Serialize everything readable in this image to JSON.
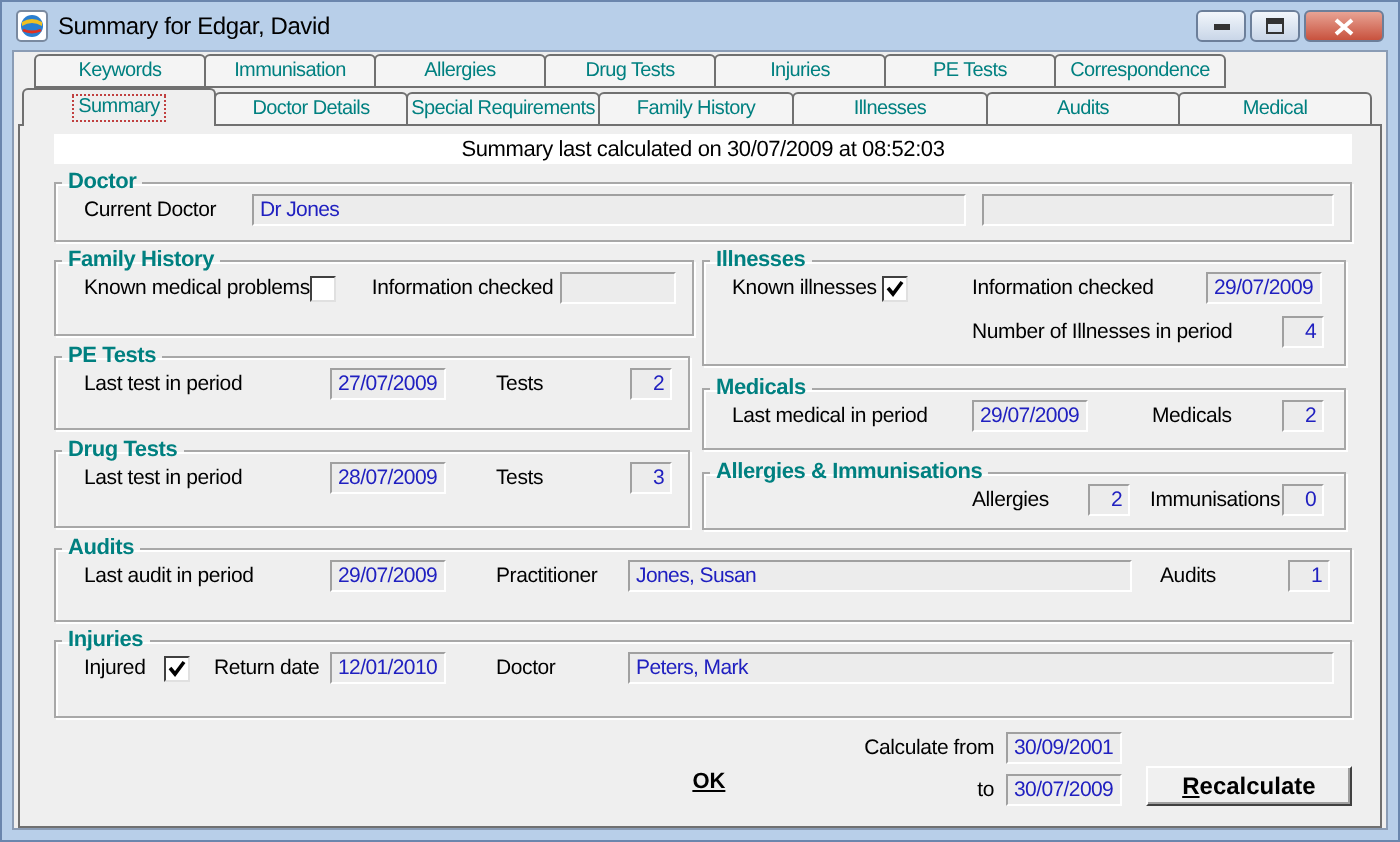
{
  "window": {
    "title": "Summary for Edgar, David"
  },
  "tab_rows": [
    {
      "tabs": [
        {
          "label": "Keywords",
          "selected": false
        },
        {
          "label": "Immunisation",
          "selected": false
        },
        {
          "label": "Allergies",
          "selected": false
        },
        {
          "label": "Drug Tests",
          "selected": false
        },
        {
          "label": "Injuries",
          "selected": false
        },
        {
          "label": "PE Tests",
          "selected": false
        },
        {
          "label": "Correspondence",
          "selected": false
        }
      ]
    },
    {
      "tabs": [
        {
          "label": "Summary",
          "selected": true
        },
        {
          "label": "Doctor Details",
          "selected": false
        },
        {
          "label": "Special Requirements",
          "selected": false
        },
        {
          "label": "Family History",
          "selected": false
        },
        {
          "label": "Illnesses",
          "selected": false
        },
        {
          "label": "Audits",
          "selected": false
        },
        {
          "label": "Medical",
          "selected": false
        }
      ]
    }
  ],
  "summary_line": "Summary last calculated on 30/07/2009 at 08:52:03",
  "doctor": {
    "title": "Doctor",
    "label": "Current Doctor",
    "value": "Dr Jones"
  },
  "family_history": {
    "title": "Family History",
    "known_label": "Known medical problems",
    "known_checked": false,
    "checked_label": "Information checked"
  },
  "illnesses": {
    "title": "Illnesses",
    "known_label": "Known illnesses",
    "known_checked": true,
    "checked_label": "Information checked",
    "checked_value": "29/07/2009",
    "count_label": "Number of Illnesses in period",
    "count": "4"
  },
  "pe_tests": {
    "title": "PE Tests",
    "last_label": "Last test in period",
    "last_value": "27/07/2009",
    "count_label": "Tests",
    "count": "2"
  },
  "medicals": {
    "title": "Medicals",
    "last_label": "Last medical in period",
    "last_value": "29/07/2009",
    "count_label": "Medicals",
    "count": "2"
  },
  "drug_tests": {
    "title": "Drug Tests",
    "last_label": "Last test in period",
    "last_value": "28/07/2009",
    "count_label": "Tests",
    "count": "3"
  },
  "allergies": {
    "title": "Allergies & Immunisations",
    "allergies_label": "Allergies",
    "allergies": "2",
    "immunisations_label": "Immunisations",
    "immunisations": "0"
  },
  "audits": {
    "title": "Audits",
    "last_label": "Last audit in period",
    "last_value": "29/07/2009",
    "practitioner_label": "Practitioner",
    "practitioner": "Jones, Susan",
    "count_label": "Audits",
    "count": "1"
  },
  "injuries": {
    "title": "Injuries",
    "injured_label": "Injured",
    "injured_checked": true,
    "return_label": "Return date",
    "return_value": "12/01/2010",
    "doctor_label": "Doctor",
    "doctor": "Peters, Mark"
  },
  "calculate": {
    "from_label": "Calculate from",
    "from": "30/09/2001",
    "to_label": "to",
    "to": "30/07/2009"
  },
  "buttons": [
    {
      "label": "OK",
      "kind": "flat"
    },
    {
      "label": "Recalculate",
      "kind": "raised"
    }
  ]
}
